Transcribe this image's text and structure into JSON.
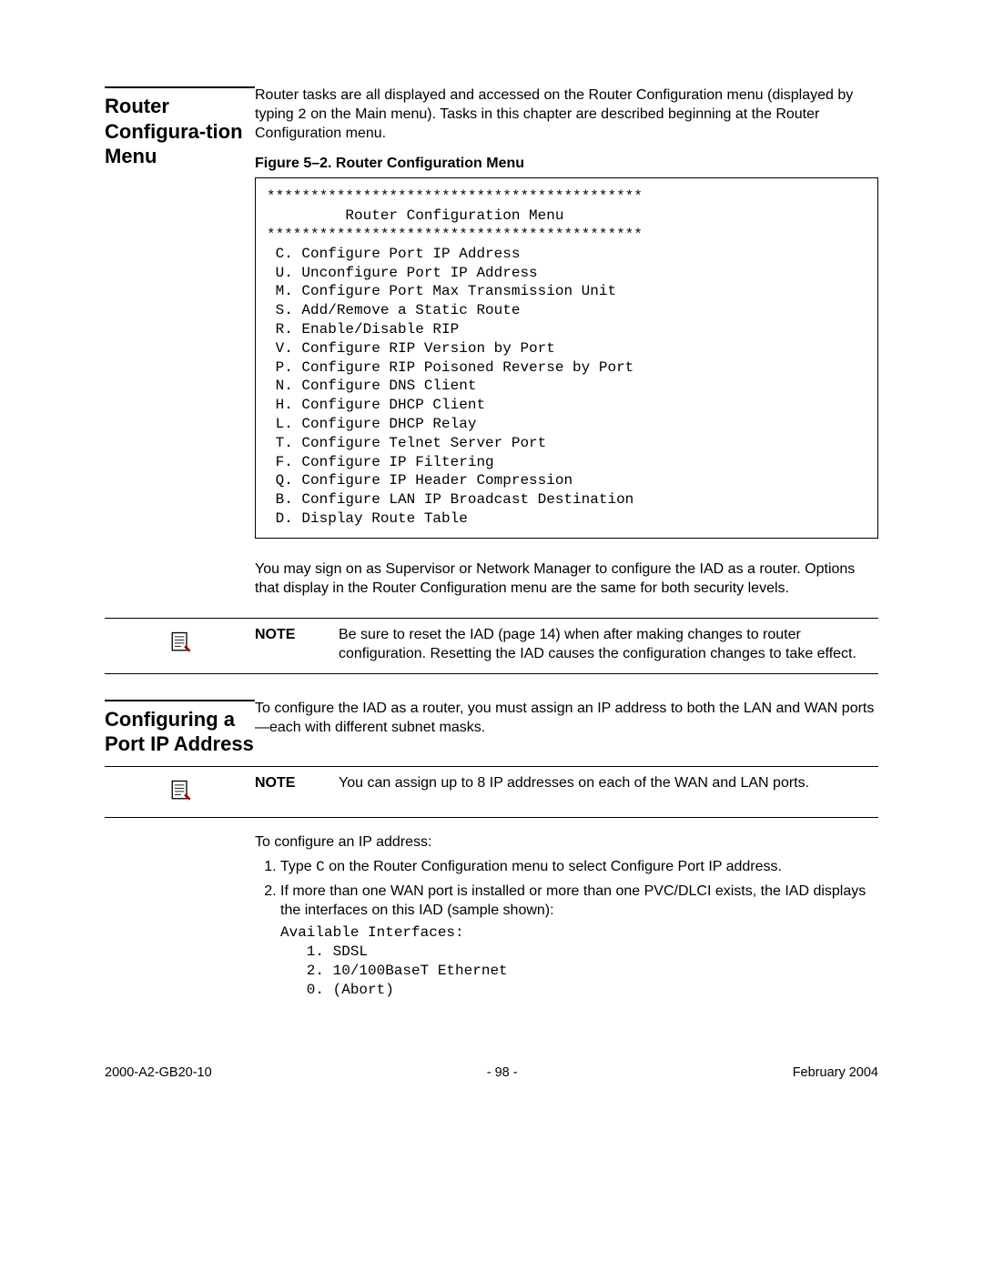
{
  "section1": {
    "title": "Router Configura-tion Menu",
    "intro_pre": "Router tasks are all displayed and accessed on the Router Configuration menu (displayed by typing ",
    "intro_key": "2",
    "intro_post": " on the Main menu). Tasks in this chapter are described beginning at the Router Configuration menu.",
    "fig_caption": "Figure 5–2.  Router Configuration Menu",
    "menu_text": "*******************************************\n         Router Configuration Menu\n*******************************************\n C. Configure Port IP Address\n U. Unconfigure Port IP Address\n M. Configure Port Max Transmission Unit\n S. Add/Remove a Static Route\n R. Enable/Disable RIP\n V. Configure RIP Version by Port\n P. Configure RIP Poisoned Reverse by Port\n N. Configure DNS Client\n H. Configure DHCP Client\n L. Configure DHCP Relay\n T. Configure Telnet Server Port\n F. Configure IP Filtering\n Q. Configure IP Header Compression\n B. Configure LAN IP Broadcast Destination\n D. Display Route Table",
    "after_menu": "You may sign on as Supervisor or Network Manager to configure the IAD as a router. Options that display in the Router Configuration menu are the same for both security levels.",
    "note_label": "NOTE",
    "note_text": "Be sure to reset the IAD (page 14) when after making changes to router configuration. Resetting the IAD causes the configuration changes to take effect."
  },
  "section2": {
    "title": "Configuring a Port IP Address",
    "intro": "To configure the IAD as a router, you must assign an IP address to both the LAN and WAN ports—each with different subnet masks.",
    "note_label": "NOTE",
    "note_text": "You can assign up to 8 IP addresses on each of the WAN and LAN ports.",
    "steps_intro": "To configure an IP address:",
    "step1_pre": "Type ",
    "step1_key": "C",
    "step1_post": " on the Router Configuration menu to select Configure Port IP address.",
    "step2": "If more than one WAN port is installed or more than one PVC/DLCI exists, the IAD displays the interfaces on this IAD (sample shown):",
    "interfaces_code": "Available Interfaces:\n   1. SDSL\n   2. 10/100BaseT Ethernet\n   0. (Abort)"
  },
  "footer": {
    "left": "2000-A2-GB20-10",
    "center": "- 98 -",
    "right": "February 2004"
  }
}
